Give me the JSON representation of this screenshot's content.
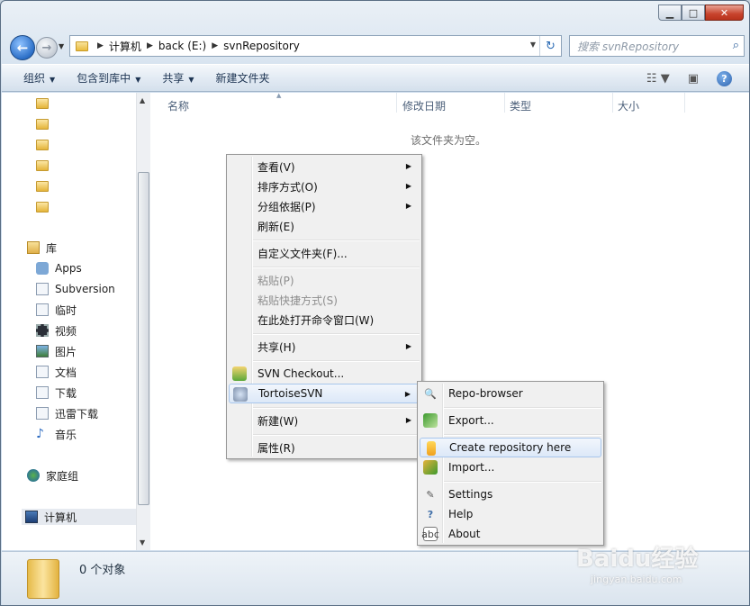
{
  "address": {
    "crumbs": [
      "计算机",
      "back (E:)",
      "svnRepository"
    ]
  },
  "search": {
    "placeholder": "搜索 svnRepository"
  },
  "toolbar": {
    "organize": "组织",
    "include_library": "包含到库中",
    "share": "共享",
    "new_folder": "新建文件夹"
  },
  "nav": {
    "library": "库",
    "items": [
      "Apps",
      "Subversion",
      "临时",
      "视频",
      "图片",
      "文档",
      "下载",
      "迅雷下载",
      "音乐"
    ],
    "homegroup": "家庭组",
    "computer": "计算机"
  },
  "columns": {
    "name": "名称",
    "modified": "修改日期",
    "type": "类型",
    "size": "大小"
  },
  "empty_message": "该文件夹为空。",
  "status": {
    "count": "0 个对象"
  },
  "context_menu": {
    "view": "查看(V)",
    "sort_by": "排序方式(O)",
    "group_by": "分组依据(P)",
    "refresh": "刷新(E)",
    "customize": "自定义文件夹(F)...",
    "paste": "粘贴(P)",
    "paste_shortcut": "粘贴快捷方式(S)",
    "open_cmd": "在此处打开命令窗口(W)",
    "share": "共享(H)",
    "svn_checkout": "SVN Checkout...",
    "tortoisesvn": "TortoiseSVN",
    "new": "新建(W)",
    "properties": "属性(R)"
  },
  "svn_submenu": {
    "repo_browser": "Repo-browser",
    "export": "Export...",
    "create_repo": "Create repository here",
    "import": "Import...",
    "settings": "Settings",
    "help": "Help",
    "about": "About"
  },
  "watermark": {
    "brand": "Baidu经验",
    "url": "jingyan.baidu.com"
  }
}
